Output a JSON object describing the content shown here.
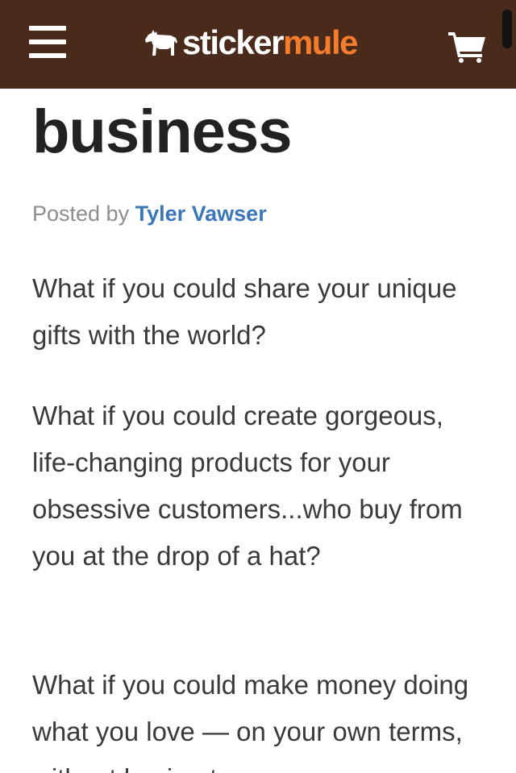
{
  "header": {
    "menu_icon": "hamburger-menu-icon",
    "logo": {
      "icon": "mule-logo-icon",
      "word_part1": "sticker",
      "word_part2": "mule",
      "color_part1": "#ffffff",
      "color_part2": "#f47c2d"
    },
    "cart_icon": "shopping-cart-icon",
    "background_color": "#4a2a1b"
  },
  "article": {
    "title": "business",
    "byline_prefix": "Posted by",
    "author": "Tyler Vawser",
    "author_color": "#3b76b8",
    "paragraphs": [
      "What if you could share your unique gifts with the world?",
      "What if you could create gorgeous, life-changing products for your obsessive customers...who buy from you at the drop of a hat?",
      "What if you could make money doing what you love — on your own terms, without having to"
    ]
  }
}
